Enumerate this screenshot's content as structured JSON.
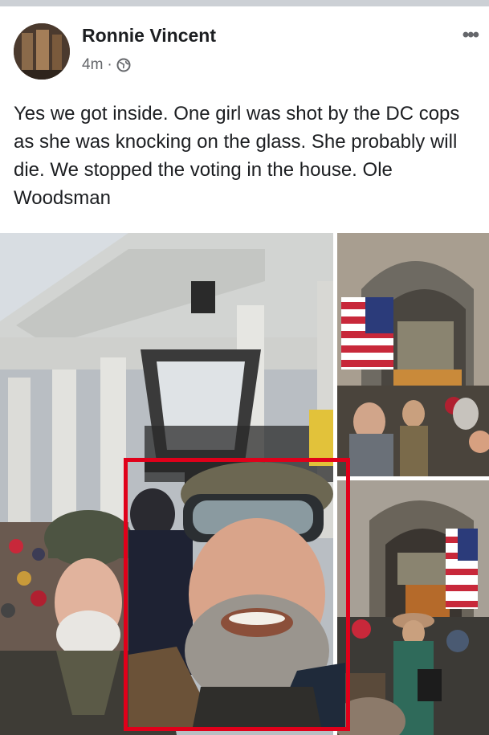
{
  "post": {
    "author": "Ronnie Vincent",
    "time": "4m",
    "separator": "·",
    "privacy_icon": "globe-icon",
    "more_icon": "more-options-icon",
    "more_label": "•••",
    "text": "Yes we got inside. One girl was shot by the DC cops as she was knocking on the glass. She probably will die. We stopped the voting in the house. Ole Woodsman"
  },
  "colors": {
    "highlight_box": "#e0001a",
    "secondary_text": "#65676b",
    "primary_text": "#1c1e21"
  }
}
